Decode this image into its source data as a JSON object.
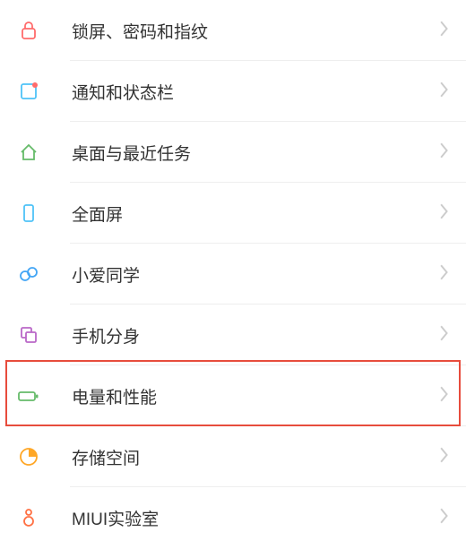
{
  "items": [
    {
      "icon": "lock",
      "label": "锁屏、密码和指纹",
      "color": "#ff6b6b"
    },
    {
      "icon": "notification",
      "label": "通知和状态栏",
      "color": "#4fc3f7"
    },
    {
      "icon": "home",
      "label": "桌面与最近任务",
      "color": "#66bb6a"
    },
    {
      "icon": "fullscreen",
      "label": "全面屏",
      "color": "#4fc3f7"
    },
    {
      "icon": "xiaoai",
      "label": "小爱同学",
      "color": "#42a5f5"
    },
    {
      "icon": "clone",
      "label": "手机分身",
      "color": "#ba68c8"
    },
    {
      "icon": "battery",
      "label": "电量和性能",
      "color": "#66bb6a"
    },
    {
      "icon": "storage",
      "label": "存储空间",
      "color": "#ffa726"
    },
    {
      "icon": "lab",
      "label": "MIUI实验室",
      "color": "#ff7043"
    }
  ],
  "highlighted_index": 6
}
